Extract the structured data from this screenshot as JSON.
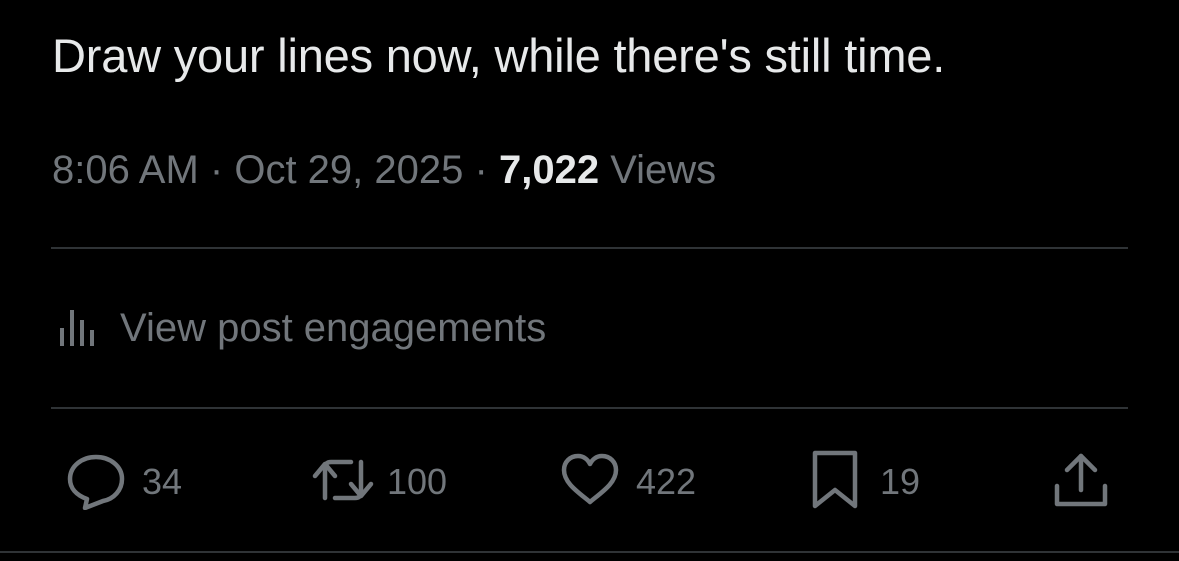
{
  "tweet": {
    "text": "Draw your lines now, while there's still time.",
    "time": "8:06 AM",
    "separator_1": "·",
    "date": "Oct 29, 2025",
    "separator_2": "·",
    "views_count": "7,022",
    "views_label": "Views"
  },
  "engagements": {
    "label": "View post engagements",
    "icon": "bar-chart-icon"
  },
  "actions": {
    "reply": {
      "icon": "reply-icon",
      "count": "34"
    },
    "repost": {
      "icon": "repost-icon",
      "count": "100"
    },
    "like": {
      "icon": "heart-icon",
      "count": "422"
    },
    "bookmark": {
      "icon": "bookmark-icon",
      "count": "19"
    },
    "share": {
      "icon": "share-icon"
    }
  },
  "colors": {
    "background": "#000000",
    "primary_text": "#e7e9ea",
    "secondary_text": "#71767b",
    "divider": "#2f3336"
  }
}
